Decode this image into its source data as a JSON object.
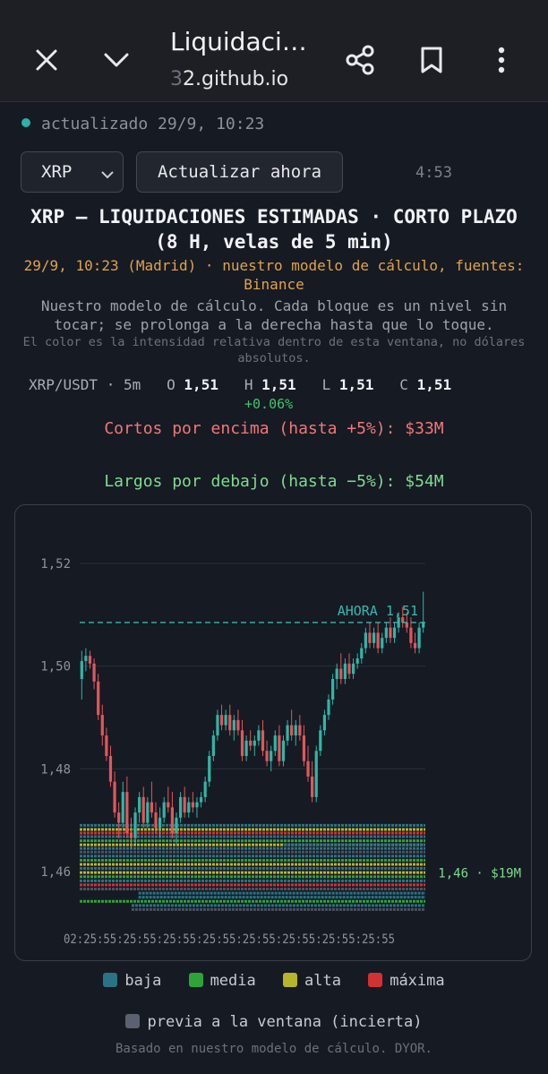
{
  "browser": {
    "title": "Liquidaci…",
    "url_faded": "3",
    "url": "2.github.io",
    "icons": [
      "close-icon",
      "chevron-down-icon",
      "share-icon",
      "bookmark-icon",
      "more-vert-icon"
    ]
  },
  "status": {
    "text": "actualizado 29/9, 10:23",
    "color": "#2bb3a8"
  },
  "controls": {
    "symbol": "XRP",
    "refresh_label": "Actualizar ahora",
    "countdown": "4:53"
  },
  "heading": {
    "title": "XRP — LIQUIDACIONES ESTIMADAS · CORTO PLAZO (8 H, velas de 5 min)",
    "meta": "29/9, 10:23 (Madrid) · nuestro modelo de cálculo, fuentes: Binance",
    "desc": "Nuestro modelo de cálculo. Cada bloque es un nivel sin tocar; se prolonga a la derecha hasta que lo toque.",
    "note": "El color es la intensidad relativa dentro de esta ventana, no dólares absolutos."
  },
  "ohlc": {
    "pair": "XRP/USDT · 5m",
    "o_label": "O",
    "o": "1,51",
    "h_label": "H",
    "h": "1,51",
    "l_label": "L",
    "l": "1,51",
    "c_label": "C",
    "c": "1,51",
    "change": "+0.06%"
  },
  "totals": {
    "shorts": "Cortos por encima (hasta +5%): $33M",
    "longs": "Largos por debajo (hasta −5%): $54M"
  },
  "chart_data": {
    "type": "candlestick",
    "ylim": [
      1.455,
      1.525
    ],
    "yticks": [
      "1,52",
      "1,50",
      "1,48",
      "1,46"
    ],
    "yticks_values": [
      1.52,
      1.5,
      1.48,
      1.46
    ],
    "xtick_labels_overlapping": "02:25:55:25:55:25:55:25:55:25:55:25:55:25:55:25:55",
    "now_label": "AHORA 1,51",
    "now_price": 1.5085,
    "right_label": "1,46 · $19M",
    "candles": [
      [
        1.4975,
        1.503,
        1.4935,
        1.501
      ],
      [
        1.501,
        1.5035,
        1.499,
        1.502
      ],
      [
        1.502,
        1.503,
        1.4995,
        1.5005
      ],
      [
        1.5005,
        1.5015,
        1.4955,
        1.497
      ],
      [
        1.497,
        1.4985,
        1.4895,
        1.4905
      ],
      [
        1.4905,
        1.4925,
        1.4845,
        1.4865
      ],
      [
        1.4865,
        1.488,
        1.4815,
        1.4825
      ],
      [
        1.4825,
        1.4845,
        1.4765,
        1.4775
      ],
      [
        1.4775,
        1.4795,
        1.4705,
        1.4715
      ],
      [
        1.4715,
        1.4735,
        1.4665,
        1.4695
      ],
      [
        1.4695,
        1.4775,
        1.4685,
        1.4755
      ],
      [
        1.4755,
        1.4785,
        1.4665,
        1.4675
      ],
      [
        1.4675,
        1.4705,
        1.4645,
        1.4665
      ],
      [
        1.4665,
        1.4725,
        1.4655,
        1.4715
      ],
      [
        1.4715,
        1.4755,
        1.4695,
        1.4745
      ],
      [
        1.4745,
        1.4765,
        1.4685,
        1.4695
      ],
      [
        1.4695,
        1.4745,
        1.4685,
        1.4735
      ],
      [
        1.4735,
        1.4775,
        1.4705,
        1.4715
      ],
      [
        1.4715,
        1.4735,
        1.4675,
        1.4685
      ],
      [
        1.4685,
        1.4725,
        1.4665,
        1.4705
      ],
      [
        1.4705,
        1.4745,
        1.4695,
        1.4735
      ],
      [
        1.4735,
        1.4765,
        1.4715,
        1.4725
      ],
      [
        1.4725,
        1.4755,
        1.4665,
        1.4675
      ],
      [
        1.4675,
        1.4715,
        1.4655,
        1.4705
      ],
      [
        1.4705,
        1.4755,
        1.4695,
        1.4745
      ],
      [
        1.4745,
        1.4765,
        1.4705,
        1.4715
      ],
      [
        1.4715,
        1.4745,
        1.4705,
        1.4735
      ],
      [
        1.4735,
        1.4755,
        1.4715,
        1.4725
      ],
      [
        1.4725,
        1.4745,
        1.4705,
        1.4735
      ],
      [
        1.4735,
        1.4755,
        1.4725,
        1.4745
      ],
      [
        1.4745,
        1.4785,
        1.4735,
        1.4775
      ],
      [
        1.4775,
        1.4835,
        1.4765,
        1.4825
      ],
      [
        1.4825,
        1.4875,
        1.4815,
        1.4865
      ],
      [
        1.4865,
        1.4915,
        1.4855,
        1.4905
      ],
      [
        1.4905,
        1.4925,
        1.4875,
        1.4885
      ],
      [
        1.4885,
        1.4915,
        1.4875,
        1.4905
      ],
      [
        1.4905,
        1.4925,
        1.4865,
        1.4875
      ],
      [
        1.4875,
        1.4905,
        1.4855,
        1.4895
      ],
      [
        1.4895,
        1.4915,
        1.4865,
        1.4875
      ],
      [
        1.4875,
        1.4895,
        1.4815,
        1.4825
      ],
      [
        1.4825,
        1.4865,
        1.4815,
        1.4855
      ],
      [
        1.4855,
        1.4875,
        1.4835,
        1.4845
      ],
      [
        1.4845,
        1.4865,
        1.4825,
        1.4855
      ],
      [
        1.4855,
        1.4885,
        1.4845,
        1.4875
      ],
      [
        1.4875,
        1.4895,
        1.4825,
        1.4835
      ],
      [
        1.4835,
        1.4855,
        1.4805,
        1.4815
      ],
      [
        1.4815,
        1.4845,
        1.4795,
        1.4835
      ],
      [
        1.4835,
        1.4875,
        1.4825,
        1.4865
      ],
      [
        1.4865,
        1.4885,
        1.4805,
        1.4815
      ],
      [
        1.4815,
        1.4865,
        1.4805,
        1.4855
      ],
      [
        1.4855,
        1.4895,
        1.4845,
        1.4885
      ],
      [
        1.4885,
        1.4915,
        1.4855,
        1.4865
      ],
      [
        1.4865,
        1.4895,
        1.4845,
        1.4885
      ],
      [
        1.4885,
        1.4905,
        1.4855,
        1.4865
      ],
      [
        1.4865,
        1.4885,
        1.4805,
        1.4815
      ],
      [
        1.4815,
        1.4845,
        1.4775,
        1.4785
      ],
      [
        1.4785,
        1.4815,
        1.4735,
        1.4745
      ],
      [
        1.4745,
        1.4845,
        1.4735,
        1.4835
      ],
      [
        1.4835,
        1.4885,
        1.4825,
        1.4875
      ],
      [
        1.4875,
        1.4915,
        1.4865,
        1.4905
      ],
      [
        1.4905,
        1.4945,
        1.4895,
        1.4935
      ],
      [
        1.4935,
        1.4985,
        1.4925,
        1.4975
      ],
      [
        1.4975,
        1.5005,
        1.4955,
        1.4995
      ],
      [
        1.4995,
        1.5025,
        1.4965,
        1.4975
      ],
      [
        1.4975,
        1.5015,
        1.4965,
        1.5005
      ],
      [
        1.5005,
        1.5025,
        1.4975,
        1.4985
      ],
      [
        1.4985,
        1.5015,
        1.4975,
        1.5005
      ],
      [
        1.5005,
        1.5025,
        1.4995,
        1.5015
      ],
      [
        1.5015,
        1.5045,
        1.5005,
        1.5035
      ],
      [
        1.5035,
        1.5075,
        1.5025,
        1.5065
      ],
      [
        1.5065,
        1.5085,
        1.5035,
        1.5045
      ],
      [
        1.5045,
        1.5075,
        1.5035,
        1.5065
      ],
      [
        1.5065,
        1.5085,
        1.5025,
        1.5035
      ],
      [
        1.5035,
        1.5065,
        1.5025,
        1.5055
      ],
      [
        1.5055,
        1.5085,
        1.5045,
        1.5075
      ],
      [
        1.5075,
        1.5095,
        1.5045,
        1.5055
      ],
      [
        1.5055,
        1.5085,
        1.5045,
        1.5075
      ],
      [
        1.5075,
        1.5105,
        1.5065,
        1.5095
      ],
      [
        1.5095,
        1.5115,
        1.5075,
        1.5085
      ],
      [
        1.5085,
        1.5105,
        1.5065,
        1.5075
      ],
      [
        1.5075,
        1.5095,
        1.5035,
        1.5045
      ],
      [
        1.5045,
        1.5065,
        1.5025,
        1.5035
      ],
      [
        1.5035,
        1.5085,
        1.5025,
        1.5075
      ],
      [
        1.5075,
        1.5145,
        1.5065,
        1.5085
      ]
    ],
    "levels": [
      {
        "price": 1.469,
        "intensity": "baja",
        "from": 0.0
      },
      {
        "price": 1.4682,
        "intensity": "alta",
        "from": 0.0
      },
      {
        "price": 1.4675,
        "intensity": "maxima",
        "from": 0.0
      },
      {
        "price": 1.4668,
        "intensity": "baja",
        "from": 0.0
      },
      {
        "price": 1.466,
        "intensity": "media",
        "from": 0.0
      },
      {
        "price": 1.4652,
        "intensity": "alta",
        "from": 0.0
      },
      {
        "price": 1.4645,
        "intensity": "baja",
        "from": 0.0
      },
      {
        "price": 1.4638,
        "intensity": "previa",
        "from": 0.0
      },
      {
        "price": 1.4652,
        "intensity": "baja",
        "from": 0.59
      },
      {
        "price": 1.463,
        "intensity": "baja",
        "from": 0.0
      },
      {
        "price": 1.4622,
        "intensity": "media",
        "from": 0.0
      },
      {
        "price": 1.4614,
        "intensity": "alta",
        "from": 0.0
      },
      {
        "price": 1.4606,
        "intensity": "baja",
        "from": 0.0
      },
      {
        "price": 1.4598,
        "intensity": "alta",
        "from": 0.0
      },
      {
        "price": 1.459,
        "intensity": "media",
        "from": 0.0
      },
      {
        "price": 1.4582,
        "intensity": "baja",
        "from": 0.0
      },
      {
        "price": 1.4574,
        "intensity": "maxima",
        "from": 0.0
      },
      {
        "price": 1.4566,
        "intensity": "previa",
        "from": 0.0
      },
      {
        "price": 1.4558,
        "intensity": "baja",
        "from": 0.17
      },
      {
        "price": 1.455,
        "intensity": "baja",
        "from": 0.17
      },
      {
        "price": 1.4542,
        "intensity": "media",
        "from": 0.0
      },
      {
        "price": 1.4534,
        "intensity": "baja",
        "from": 0.15
      },
      {
        "price": 1.4526,
        "intensity": "previa",
        "from": 0.15
      }
    ]
  },
  "legend": {
    "items": [
      {
        "label": "baja",
        "color": "#2b7384"
      },
      {
        "label": "media",
        "color": "#2ea33a"
      },
      {
        "label": "alta",
        "color": "#b7b52c"
      },
      {
        "label": "máxima",
        "color": "#d23232"
      }
    ],
    "previa": {
      "label": "previa a la ventana (incierta)",
      "color": "#5b6170"
    }
  },
  "footer": "Basado en nuestro modelo de cálculo. DYOR."
}
